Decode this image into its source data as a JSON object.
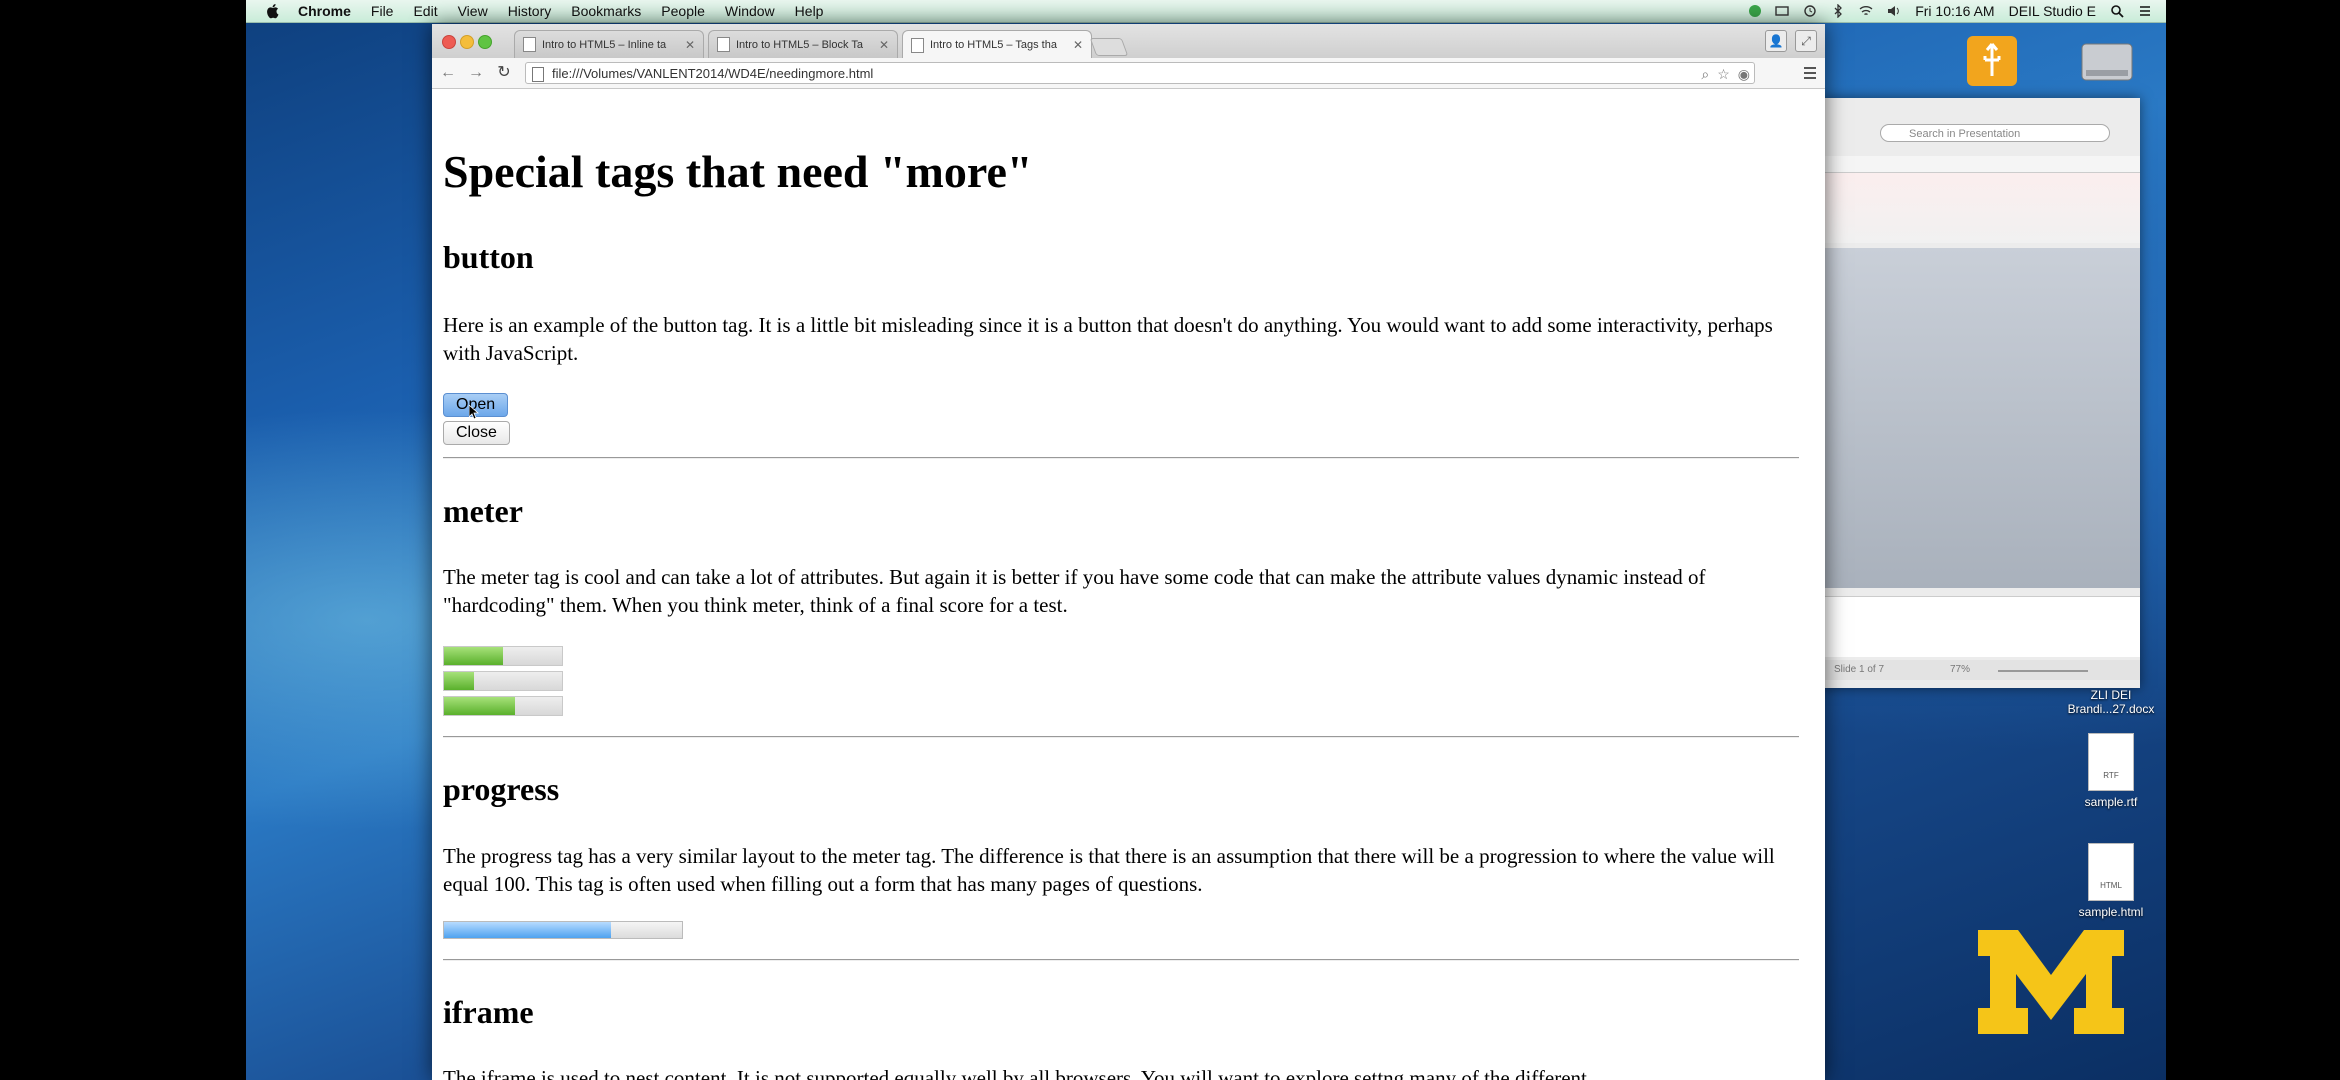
{
  "menubar": {
    "items": [
      "Chrome",
      "File",
      "Edit",
      "View",
      "History",
      "Bookmarks",
      "People",
      "Window",
      "Help"
    ],
    "clock": "Fri 10:16 AM",
    "user": "DEIL Studio E"
  },
  "browser": {
    "tabs": [
      {
        "title": "Intro to HTML5 – Inline ta",
        "active": false
      },
      {
        "title": "Intro to HTML5 – Block Ta",
        "active": false
      },
      {
        "title": "Intro to HTML5 – Tags tha",
        "active": true
      }
    ],
    "url": "file:///Volumes/VANLENT2014/WD4E/needingmore.html"
  },
  "page": {
    "title": "Special tags that need \"more\"",
    "sections": {
      "button": {
        "heading": "button",
        "text": "Here is an example of the button tag. It is a little bit misleading since it is a button that doesn't do anything. You would want to add some interactivity, perhaps with JavaScript.",
        "open_label": "Open",
        "close_label": "Close"
      },
      "meter": {
        "heading": "meter",
        "text": "The meter tag is cool and can take a lot of attributes. But again it is better if you have some code that can make the attribute values dynamic instead of \"hardcoding\" them. When you think meter, think of a final score for a test.",
        "values": [
          0.5,
          0.25,
          0.6
        ]
      },
      "progress": {
        "heading": "progress",
        "text": "The progress tag has a very similar layout to the meter tag. The difference is that there is an assumption that there will be a progression to where the value will equal 100. This tag is often used when filling out a form that has many pages of questions.",
        "value": 0.7
      },
      "iframe": {
        "heading": "iframe",
        "text": "The iframe is used to nest content. It is not supported equally well by all browsers. You will want to explore settng many of the different"
      }
    }
  },
  "presentation": {
    "search_placeholder": "Search in Presentation",
    "slide_status": "Slide 1 of 7",
    "zoom": "77%"
  },
  "desktop": {
    "icons": [
      {
        "label": "ZLI DEI Brandi...27.docx",
        "kind": ""
      },
      {
        "label": "sample.rtf",
        "kind": "RTF"
      },
      {
        "label": "sample.html",
        "kind": "HTML"
      }
    ]
  },
  "colors": {
    "meter_fill": "#5ab02c",
    "progress_fill": "#4ea2f0",
    "button_focus": "#6ca7ea",
    "logo_maize": "#f5c518"
  }
}
